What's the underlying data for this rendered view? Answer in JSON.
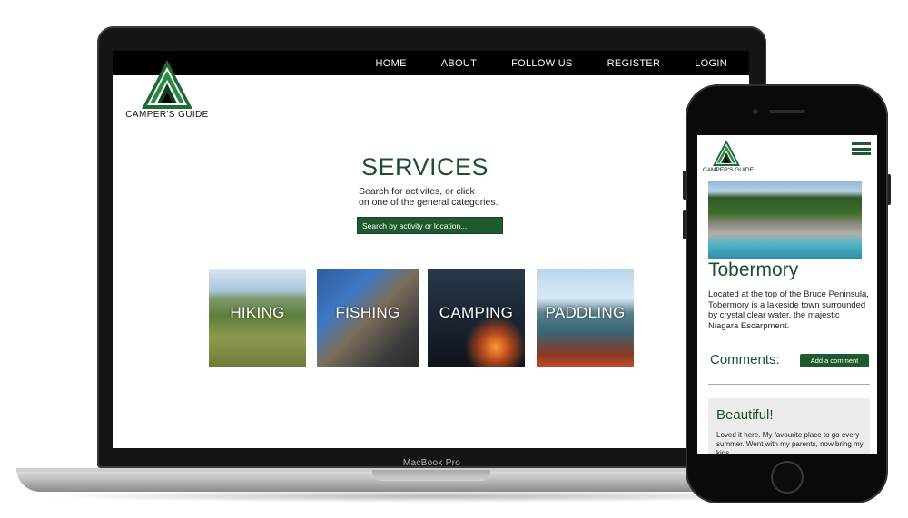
{
  "nav": {
    "items": [
      "HOME",
      "ABOUT",
      "FOLLOW US",
      "REGISTER",
      "LOGIN"
    ]
  },
  "logo": {
    "text": "CAMPER'S GUIDE",
    "icon": "pine-tree-logo"
  },
  "services": {
    "title": "SERVICES",
    "subtitle_line1": "Search for activites, or click",
    "subtitle_line2": "on one of the general categories.",
    "search_placeholder": "Search by activity or location..."
  },
  "categories": [
    {
      "label": "HIKING"
    },
    {
      "label": "FISHING"
    },
    {
      "label": "CAMPING"
    },
    {
      "label": "PADDLING"
    }
  ],
  "device_label": "MacBook Pro",
  "mobile": {
    "logo_text": "CAMPER'S GUIDE",
    "menu_icon": "hamburger-icon",
    "title": "Tobermory",
    "description": "Located at the top of the Bruce Peninsula, Tobermory is a lakeside town surrounded by crystal clear water, the majestic Niagara Escarpment.",
    "comments_label": "Comments:",
    "add_comment_label": "Add a comment",
    "comment": {
      "title": "Beautiful!",
      "body": "Loved it here. My favourite place to go every summer. Went with my parents, now bring my kids."
    }
  },
  "colors": {
    "brand_green": "#1e5a2e",
    "title_green": "#1c4f2c",
    "nav_bg": "#000000"
  }
}
